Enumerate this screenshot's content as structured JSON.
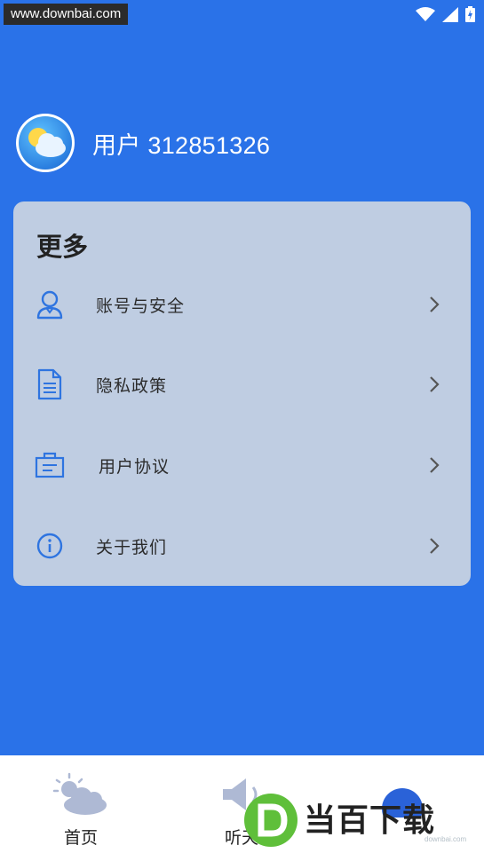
{
  "status_bar": {
    "watermark_url": "www.downbai.com"
  },
  "profile": {
    "username": "用户 312851326"
  },
  "more_card": {
    "title": "更多",
    "items": [
      {
        "label": "账号与安全",
        "icon": "user-icon"
      },
      {
        "label": "隐私政策",
        "icon": "document-icon"
      },
      {
        "label": "用户协议",
        "icon": "agreement-icon"
      },
      {
        "label": "关于我们",
        "icon": "info-icon"
      }
    ]
  },
  "bottom_nav": {
    "items": [
      {
        "label": "首页",
        "icon": "weather-cloud-icon"
      },
      {
        "label": "听天",
        "icon": "speaker-icon"
      },
      {
        "label": "",
        "icon": "profile-tab-icon"
      }
    ]
  },
  "watermark_logo": {
    "text": "当百下载",
    "sub": "downbai.com"
  },
  "colors": {
    "background": "#2a72e8",
    "card": "#bfcde2",
    "icon_blue": "#2e74e0"
  }
}
